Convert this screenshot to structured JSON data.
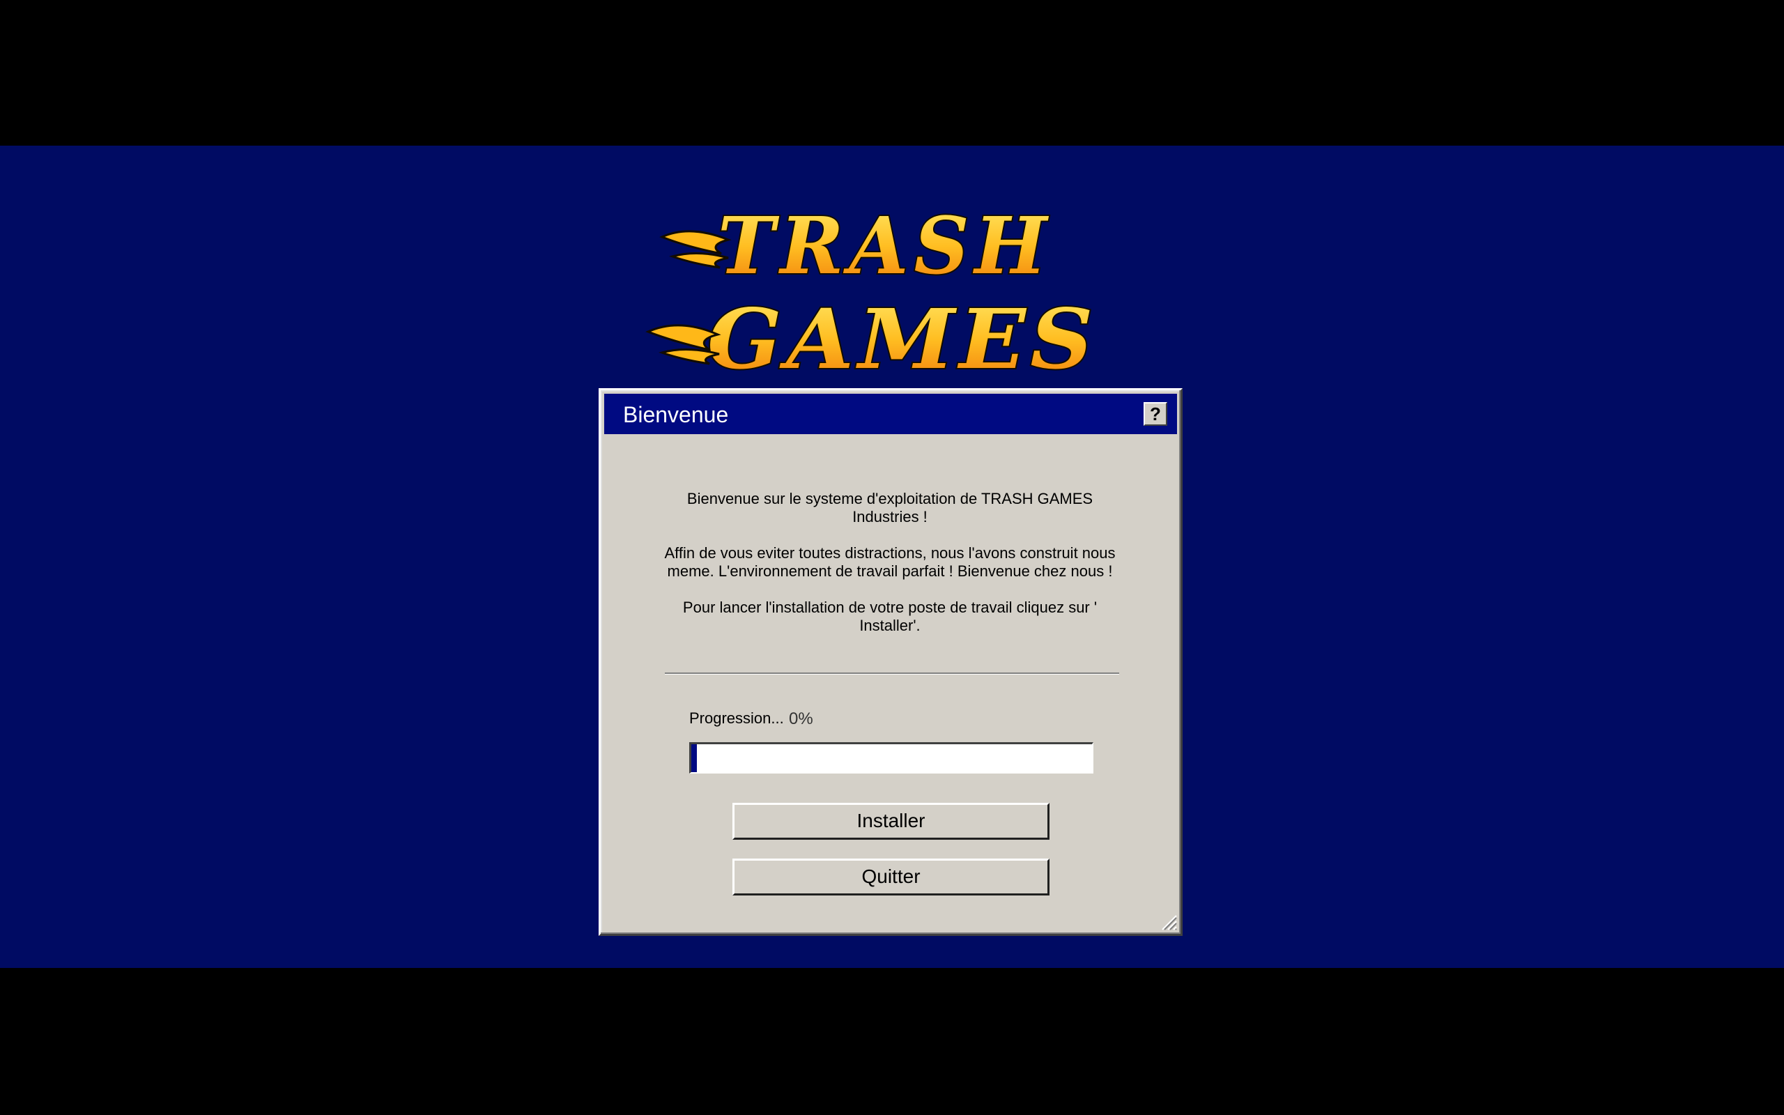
{
  "logo": {
    "text": "TRASH GAMES",
    "colors": {
      "flame_top": "#ffd23a",
      "flame_bottom": "#f08a10",
      "outline": "#1a1300"
    }
  },
  "dialog": {
    "title": "Bienvenue",
    "help_label": "?",
    "message": [
      "Bienvenue sur le systeme d'exploitation de TRASH GAMES Industries !",
      "Affin de vous eviter toutes distractions, nous l'avons construit nous meme. L'environnement de travail parfait ! Bienvenue chez nous !",
      "Pour lancer l'installation de votre poste de travail cliquez sur ' Installer'."
    ],
    "progress": {
      "label": "Progression...",
      "value_text": "0%",
      "value": 0
    },
    "buttons": {
      "install": "Installer",
      "quit": "Quitter"
    }
  },
  "colors": {
    "desktop": "#000b63",
    "titlebar": "#000a82",
    "dialog_bg": "#d4d0c8"
  },
  "icons": {
    "help": "question-icon",
    "resize": "resize-grip-icon"
  }
}
